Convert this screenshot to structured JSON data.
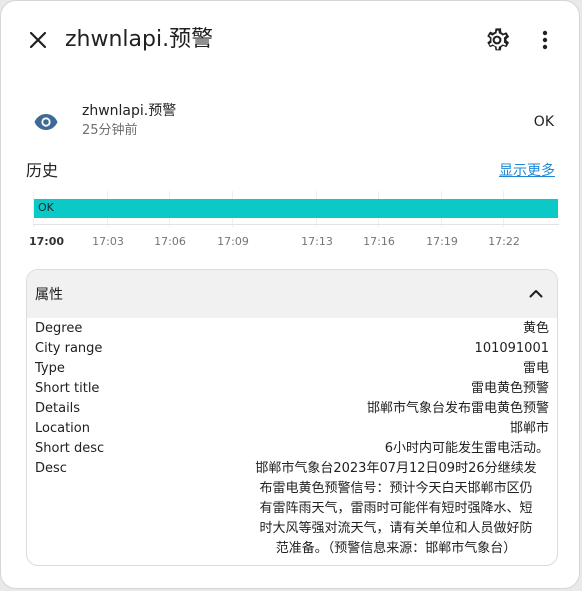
{
  "header": {
    "title": "zhwnlapi.预警",
    "close_icon": "close-icon",
    "settings_icon": "gear-icon",
    "more_icon": "more-vertical-icon"
  },
  "entity": {
    "icon": "eye-icon",
    "icon_color": "#3f6a96",
    "name": "zhwnlapi.预警",
    "last_changed": "25分钟前",
    "state": "OK"
  },
  "history": {
    "title": "历史",
    "show_more_label": "显示更多",
    "bar_color": "#0ac9c6",
    "bar_label": "OK",
    "ticks": [
      "17:00",
      "17:03",
      "17:06",
      "17:09",
      "17:13",
      "17:16",
      "17:19",
      "17:22"
    ]
  },
  "attributes": {
    "title": "属性",
    "rows": [
      {
        "key": "Degree",
        "value": "黄色"
      },
      {
        "key": "City range",
        "value": "101091001"
      },
      {
        "key": "Type",
        "value": "雷电"
      },
      {
        "key": "Short title",
        "value": "雷电黄色预警"
      },
      {
        "key": "Details",
        "value": "邯郸市气象台发布雷电黄色预警"
      },
      {
        "key": "Location",
        "value": "邯郸市"
      },
      {
        "key": "Short desc",
        "value": "6小时内可能发生雷电活动。"
      },
      {
        "key": "Desc",
        "value_lines": [
          "邯郸市气象台2023年07月12日09时26分继续发",
          "布雷电黄色预警信号：预计今天白天邯郸市区仍",
          "有雷阵雨天气，雷雨时可能伴有短时强降水、短",
          "时大风等强对流天气，请有关单位和人员做好防",
          "范准备。（预警信息来源：邯郸市气象台）"
        ]
      }
    ]
  }
}
